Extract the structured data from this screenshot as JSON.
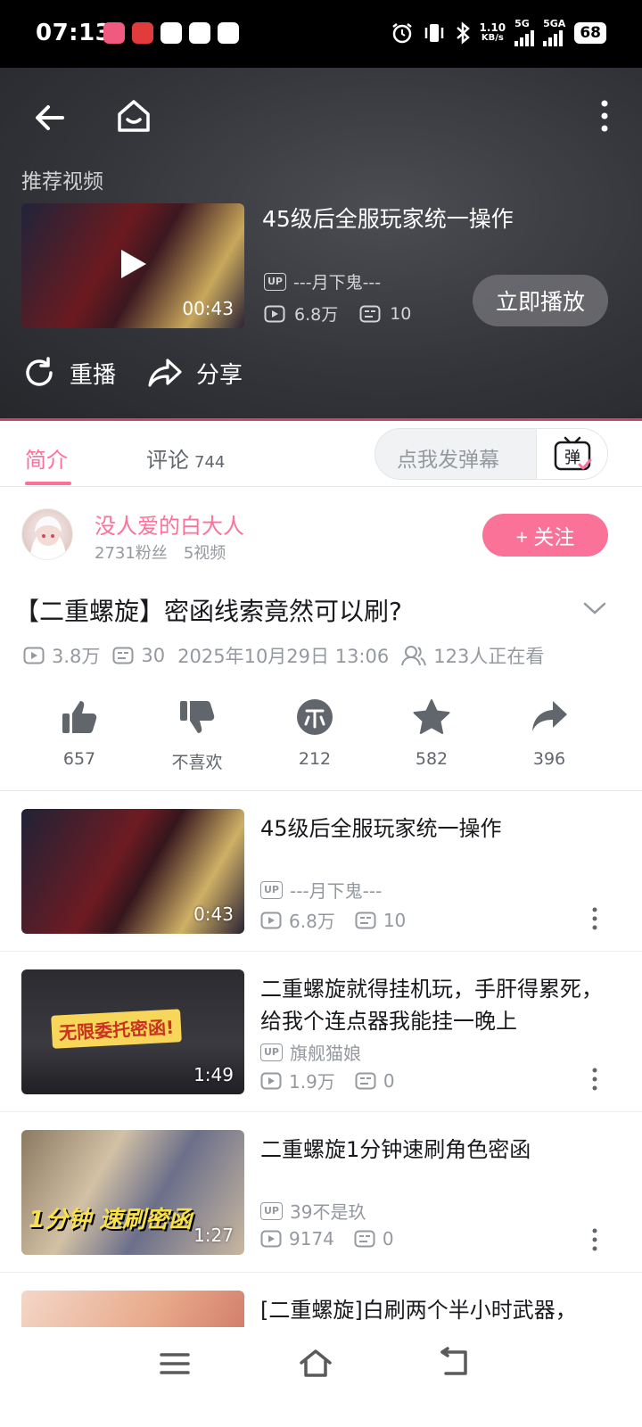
{
  "status_bar": {
    "time": "07:13",
    "network_speed": "1.10",
    "network_speed_unit": "KB/s",
    "net1": "5G",
    "net2": "5GA",
    "battery": "68"
  },
  "player": {
    "recommend_label": "推荐视频",
    "title": "45级后全服玩家统一操作",
    "uploader": "---月下鬼---",
    "views": "6.8万",
    "danmaku_count": "10",
    "duration": "00:43",
    "play_now_label": "立即播放",
    "replay_label": "重播",
    "share_label": "分享"
  },
  "tabs": {
    "intro_label": "简介",
    "comment_label": "评论",
    "comment_count": "744",
    "danmaku_placeholder": "点我发弹幕",
    "danmaku_button": "弹"
  },
  "uploader": {
    "name": "没人爱的白大人",
    "fans": "2731粉丝",
    "videos": "5视频",
    "follow_label": "+ 关注"
  },
  "video": {
    "title": "【二重螺旋】密函线索竟然可以刷?",
    "views": "3.8万",
    "danmaku": "30",
    "date": "2025年10月29日 13:06",
    "watching": "123人正在看"
  },
  "actions": {
    "like": "657",
    "dislike": "不喜欢",
    "coin": "212",
    "favorite": "582",
    "share": "396"
  },
  "related": [
    {
      "title": "45级后全服玩家统一操作",
      "uploader": "---月下鬼---",
      "views": "6.8万",
      "danmaku": "10",
      "duration": "0:43"
    },
    {
      "title": "二重螺旋就得挂机玩，手肝得累死，给我个连点器我能挂一晚上",
      "uploader": "旗舰猫娘",
      "views": "1.9万",
      "danmaku": "0",
      "duration": "1:49",
      "thumb_text": "无限委托密函!"
    },
    {
      "title": "二重螺旋1分钟速刷角色密函",
      "uploader": "39不是玖",
      "views": "9174",
      "danmaku": "0",
      "duration": "1:27",
      "thumb_text": "1分钟 速刷密函"
    },
    {
      "title": "[二重螺旋]白刷两个半小时武器，"
    }
  ],
  "up_badge": "UP",
  "colors": {
    "accent": "#fb7299",
    "status_bar": "#000000",
    "player_bg": "#2e3035"
  }
}
